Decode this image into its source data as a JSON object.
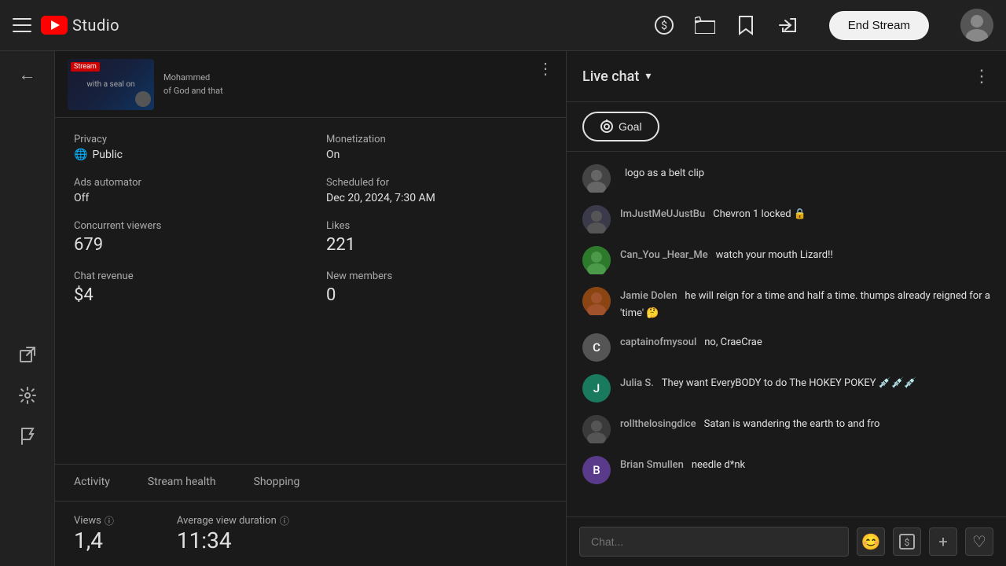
{
  "header": {
    "menu_label": "Menu",
    "logo_text": "Studio",
    "end_stream_label": "End Stream",
    "icons": {
      "monetization": "💲",
      "clapper": "🎬",
      "bookmark": "🔖",
      "share": "↗"
    }
  },
  "sidebar": {
    "icons": [
      "←",
      "⬡",
      "⚙",
      "⚑"
    ]
  },
  "stream": {
    "badge": "Stream",
    "privacy_label": "Privacy",
    "privacy_value": "Public",
    "monetization_label": "Monetization",
    "monetization_value": "On",
    "ads_label": "Ads automator",
    "ads_value": "Off",
    "scheduled_label": "Scheduled for",
    "scheduled_value": "Dec 20, 2024, 7:30 AM",
    "viewers_label": "Concurrent viewers",
    "viewers_value": "679",
    "likes_label": "Likes",
    "likes_value": "221",
    "chat_revenue_label": "Chat revenue",
    "chat_revenue_value": "$4",
    "new_members_label": "New members",
    "new_members_value": "0"
  },
  "tabs": [
    {
      "label": "Activity",
      "active": false
    },
    {
      "label": "Stream health",
      "active": false
    },
    {
      "label": "Shopping",
      "active": false
    }
  ],
  "bottom_stats": {
    "views_label": "Views",
    "views_value": "1,4",
    "avg_label": "Average view duration",
    "avg_value": "11:34"
  },
  "chat": {
    "title": "Live chat",
    "chevron": "▾",
    "more_icon": "⋮",
    "goal_label": "Goal",
    "messages": [
      {
        "id": 1,
        "username": "",
        "text": "logo as a belt clip",
        "avatar_color": "#555",
        "avatar_letter": "",
        "has_image": true
      },
      {
        "id": 2,
        "username": "ImJustMeUJustBu",
        "text": "Chevron 1 locked 🔒",
        "avatar_color": "#444",
        "avatar_letter": "I",
        "has_image": true
      },
      {
        "id": 3,
        "username": "Can_You_Hear_Me",
        "text": "watch your mouth Lizard!!",
        "avatar_color": "#2d7a2d",
        "avatar_letter": "C",
        "has_image": true
      },
      {
        "id": 4,
        "username": "Jamie Dolen",
        "text": "he will reign for a time and half a time. thumps already reigned for a 'time' 🤔",
        "avatar_color": "#8B4513",
        "avatar_letter": "J",
        "has_image": true
      },
      {
        "id": 5,
        "username": "captainofmysoul",
        "text": "no, CraeCrae",
        "avatar_color": "#555",
        "avatar_letter": "C",
        "has_image": false
      },
      {
        "id": 6,
        "username": "Julia S.",
        "text": "They want EveryBODY to do The HOKEY POKEY 💉💉💉",
        "avatar_color": "#1a7a5e",
        "avatar_letter": "J",
        "has_image": false
      },
      {
        "id": 7,
        "username": "rollthelosingdice",
        "text": "Satan is wandering the earth to and fro",
        "avatar_color": "#444",
        "avatar_letter": "R",
        "has_image": true
      },
      {
        "id": 8,
        "username": "Brian Smullen",
        "text": "needle d*nk",
        "avatar_color": "#5a3a8a",
        "avatar_letter": "B",
        "has_image": false
      }
    ],
    "input_placeholder": "Chat...",
    "input_icons": [
      "😊",
      "$",
      "+",
      "♡"
    ]
  }
}
